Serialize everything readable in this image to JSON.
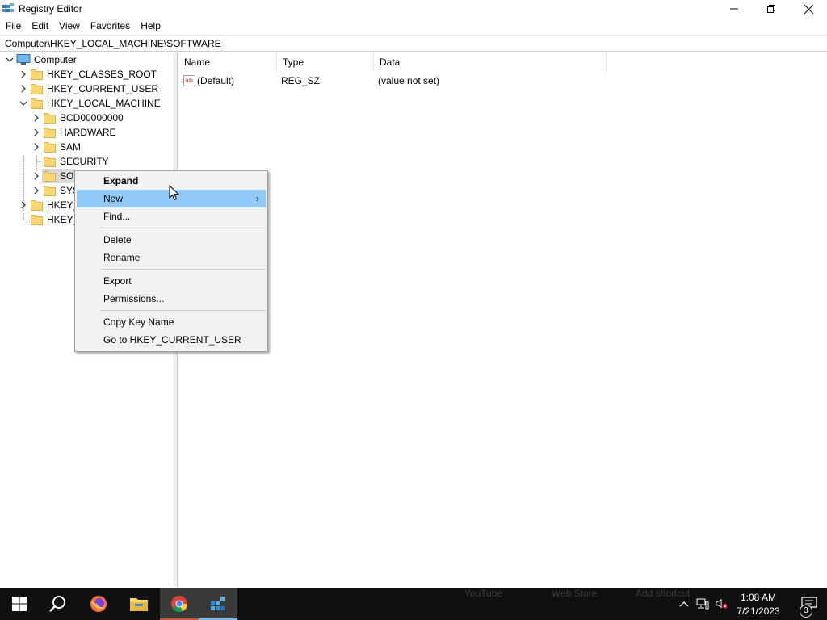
{
  "window": {
    "title": "Registry Editor"
  },
  "menu": [
    "File",
    "Edit",
    "View",
    "Favorites",
    "Help"
  ],
  "address": {
    "path": "Computer\\HKEY_LOCAL_MACHINE\\SOFTWARE"
  },
  "tree": {
    "root": "Computer",
    "hives": [
      {
        "label": "HKEY_CLASSES_ROOT"
      },
      {
        "label": "HKEY_CURRENT_USER"
      },
      {
        "label": "HKEY_LOCAL_MACHINE"
      },
      {
        "label": "HKEY_"
      },
      {
        "label": "HKEY_"
      }
    ],
    "hklm_children": [
      {
        "label": "BCD00000000"
      },
      {
        "label": "HARDWARE"
      },
      {
        "label": "SAM"
      },
      {
        "label": "SECURITY"
      },
      {
        "label": "SOF"
      },
      {
        "label": "SYS"
      }
    ]
  },
  "list": {
    "columns": [
      "Name",
      "Type",
      "Data"
    ],
    "rows": [
      {
        "name": "(Default)",
        "type": "REG_SZ",
        "data": "(value not set)",
        "icon": "string-value-icon"
      }
    ]
  },
  "context_menu": {
    "items": [
      "Expand",
      "New",
      "Find...",
      "Delete",
      "Rename",
      "Export",
      "Permissions...",
      "Copy Key Name",
      "Go to HKEY_CURRENT_USER"
    ],
    "highlighted": "New",
    "submenu_arrow": "›"
  },
  "taskbar": {
    "apps": [
      "start-icon",
      "search-icon",
      "firefox-icon",
      "file-explorer-icon",
      "chrome-icon",
      "registry-editor-icon"
    ],
    "ghost_labels": [
      "YouTube",
      "Web Store",
      "Add shortcut"
    ],
    "clock": {
      "time": "1:08 AM",
      "date": "7/21/2023"
    },
    "notifications_count": "3"
  },
  "colors": {
    "menu_highlight": "#91c9f7",
    "taskbar": "#101010",
    "active_app_underline": "#76b9ed",
    "folder": "#f8d775"
  }
}
